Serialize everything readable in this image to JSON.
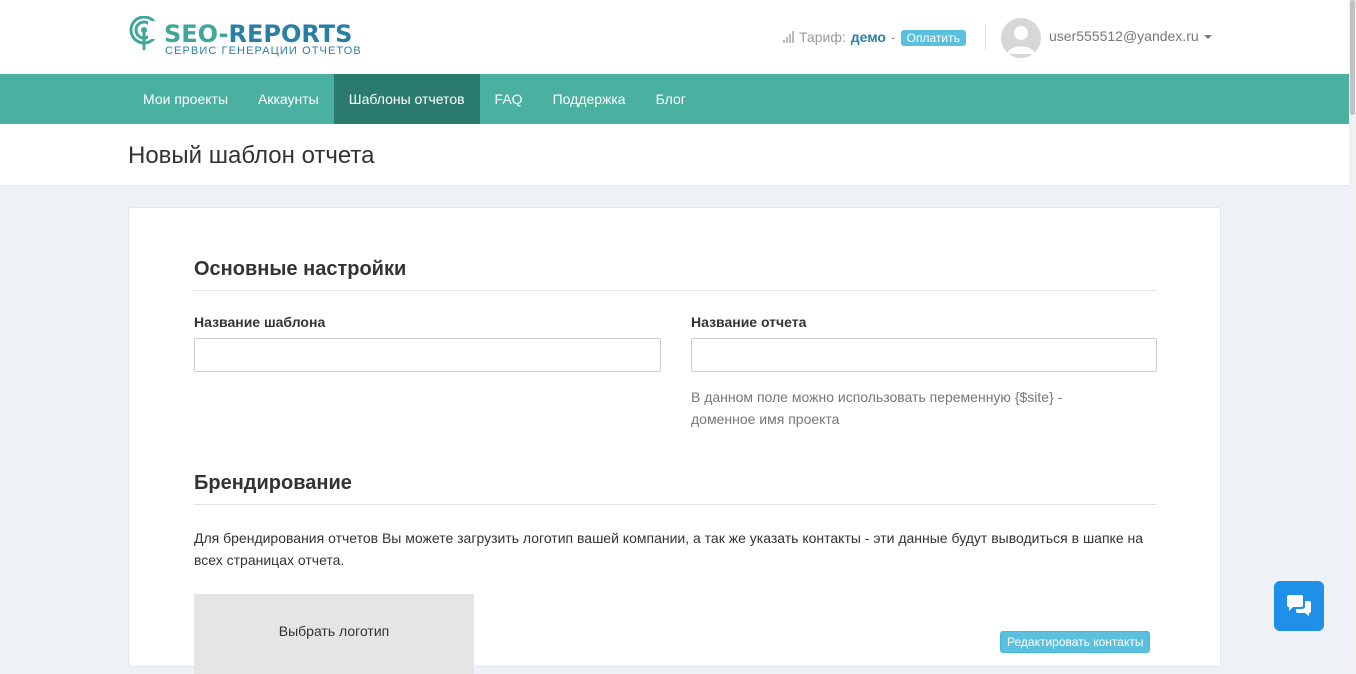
{
  "header": {
    "logo_title_part1": "SEO-",
    "logo_title_part2": "REPORTS",
    "logo_subtitle": "СЕРВИС ГЕНЕРАЦИИ ОТЧЕТОВ",
    "tariff_label": "Тариф:",
    "tariff_value": "демо",
    "tariff_separator": "-",
    "pay_button": "Оплатить",
    "user_email": "user555512@yandex.ru"
  },
  "nav": {
    "items": [
      {
        "label": "Мои проекты"
      },
      {
        "label": "Аккаунты"
      },
      {
        "label": "Шаблоны отчетов"
      },
      {
        "label": "FAQ"
      },
      {
        "label": "Поддержка"
      },
      {
        "label": "Блог"
      }
    ],
    "active_index": 2
  },
  "page": {
    "title": "Новый шаблон отчета"
  },
  "form": {
    "basic_settings_title": "Основные настройки",
    "template_name_label": "Название шаблона",
    "template_name_value": "",
    "report_name_label": "Название отчета",
    "report_name_value": "",
    "report_name_help": "В данном поле можно использовать переменную {$site} - доменное имя проекта",
    "branding_title": "Брендирование",
    "branding_description": "Для брендирования отчетов Вы можете загрузить логотип вашей компании, а так же указать контакты - эти данные будут выводиться в шапке на всех страницах отчета.",
    "choose_logo_label": "Выбрать логотип",
    "edit_contacts_button": "Редактировать контакты"
  },
  "colors": {
    "nav_bg": "#4ab0a0",
    "nav_active_bg": "#2a7a6d",
    "brand_green": "#3fa79a",
    "brand_blue": "#2a7fa5",
    "info_button": "#5bc0de",
    "chat_button": "#1e90e8"
  },
  "icons": {
    "logo": "signal-tower-icon",
    "tariff": "signal-bars-icon",
    "avatar": "user-avatar-icon",
    "dropdown": "caret-down-icon",
    "chat": "chat-bubbles-icon"
  }
}
